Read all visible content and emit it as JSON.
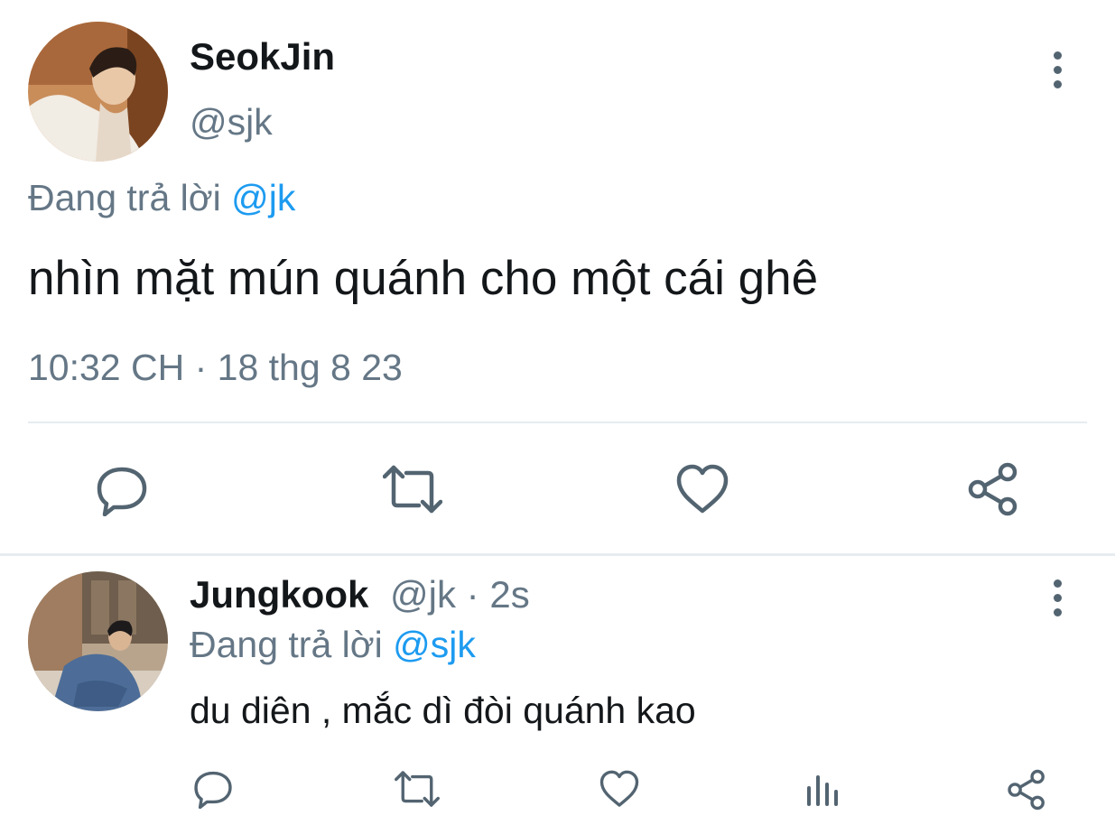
{
  "main_tweet": {
    "display_name": "SeokJin",
    "handle": "@sjk",
    "reply_prefix": "Đang trả lời",
    "reply_to": "@jk",
    "text": "nhìn mặt mún quánh cho một cái ghê",
    "timestamp": "10:32 CH · 18 thg 8 23",
    "actions": [
      "reply-icon",
      "retweet-icon",
      "like-icon",
      "share-icon"
    ]
  },
  "reply_tweet": {
    "display_name": "Jungkook",
    "handle": "@jk",
    "separator": "·",
    "time_ago": "2s",
    "reply_prefix": "Đang trả lời",
    "reply_to": "@sjk",
    "text": "du diên , mắc dì đòi quánh kao",
    "actions": [
      "reply-icon",
      "retweet-icon",
      "like-icon",
      "views-icon",
      "share-icon"
    ]
  },
  "colors": {
    "accent": "#1d9bf0",
    "muted": "#657786",
    "icon": "#536471",
    "divider": "#e6ecf0"
  }
}
